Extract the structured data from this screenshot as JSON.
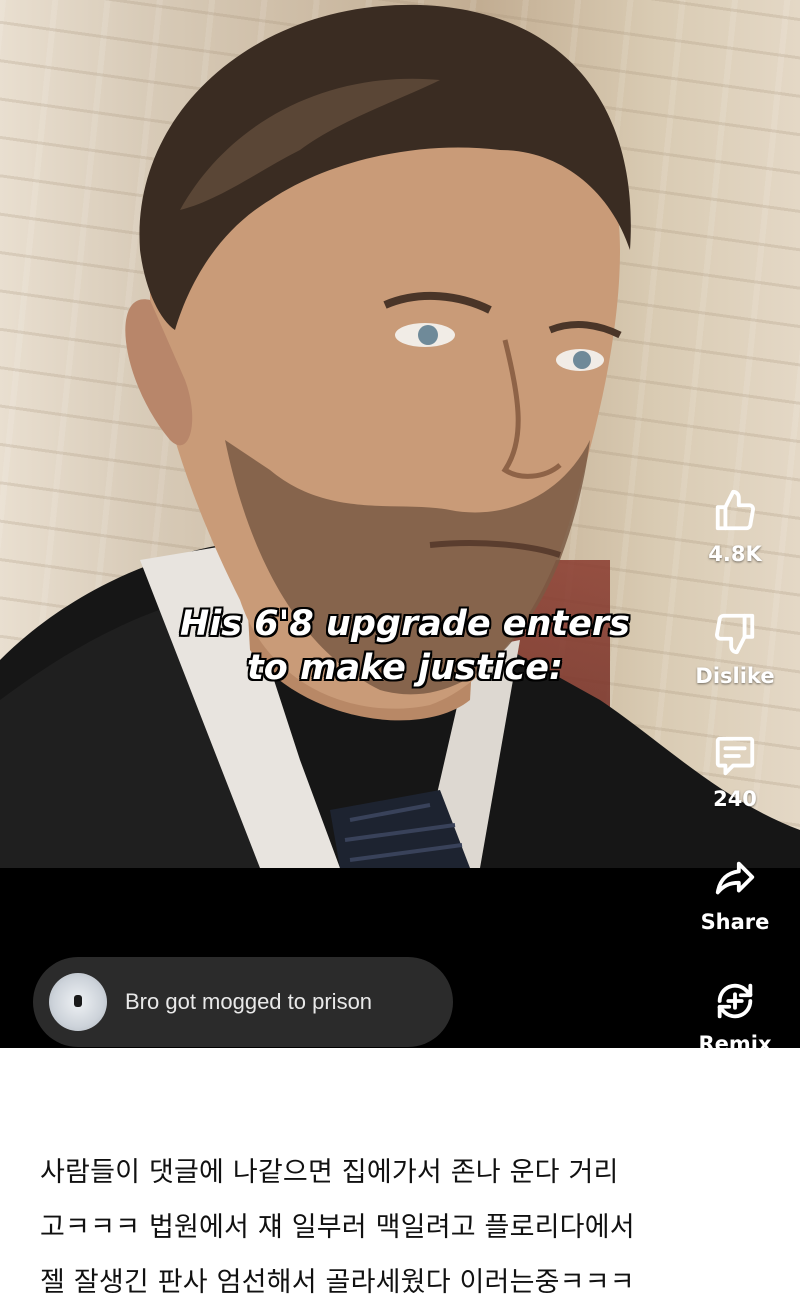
{
  "video": {
    "caption_line1": "His 6'8 upgrade enters",
    "caption_line2": "to make justice:"
  },
  "actions": {
    "like_count": "4.8K",
    "dislike_label": "Dislike",
    "comment_count": "240",
    "share_label": "Share",
    "remix_label": "Remix"
  },
  "top_comment": {
    "text": "Bro got mogged to prison"
  },
  "post": {
    "lines": [
      "사람들이 댓글에 나같으면 집에가서 존나 운다 거리",
      "고ㅋㅋㅋ 법원에서 쟤 일부러 맥일려고 플로리다에서",
      "젤 잘생긴 판사 엄선해서 골라세웠다 이러는중ㅋㅋㅋ"
    ]
  },
  "colors": {
    "video_bg": "#000000",
    "pill_bg": "#2b2b2b",
    "page_bg": "#ffffff",
    "text": "#111111"
  },
  "icons": [
    "thumbs-up-icon",
    "thumbs-down-icon",
    "comment-icon",
    "share-icon",
    "remix-icon"
  ]
}
